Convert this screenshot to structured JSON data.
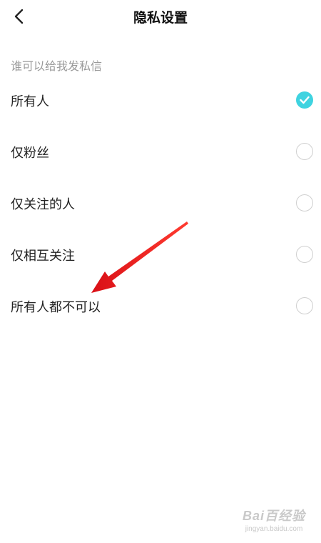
{
  "header": {
    "title": "隐私设置",
    "back_icon": "chevron-left-icon"
  },
  "section": {
    "label": "谁可以给我发私信"
  },
  "options": [
    {
      "label": "所有人",
      "checked": true
    },
    {
      "label": "仅粉丝",
      "checked": false
    },
    {
      "label": "仅关注的人",
      "checked": false
    },
    {
      "label": "仅相互关注",
      "checked": false
    },
    {
      "label": "所有人都不可以",
      "checked": false
    }
  ],
  "colors": {
    "accent": "#3fd3e0",
    "annotation_arrow": "#e8161c"
  },
  "watermark": {
    "logo": "Bai百经验",
    "url": "jingyan.baidu.com"
  }
}
